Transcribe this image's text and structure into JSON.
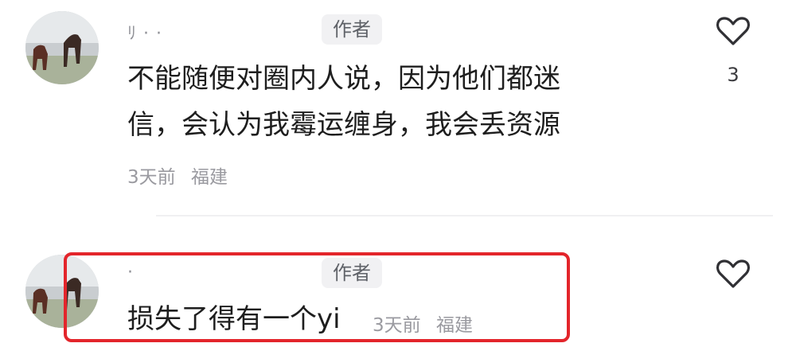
{
  "comments": [
    {
      "username": "ﾘ  ·  ·",
      "badge": "作者",
      "text_lines": [
        "不能随便对圈内人说，因为他们都迷",
        "信，会认为我霉运缠身，我会丢资源"
      ],
      "time": "3天前",
      "location": "福建",
      "likes": "3",
      "like_icon": "heart-outline-icon"
    },
    {
      "username": "·",
      "badge": "作者",
      "text": "损失了得有一个yi",
      "time": "3天前",
      "location": "福建",
      "like_icon": "heart-outline-icon"
    }
  ],
  "highlight_color": "#e3252b",
  "badge_color": "#f1f1f3"
}
